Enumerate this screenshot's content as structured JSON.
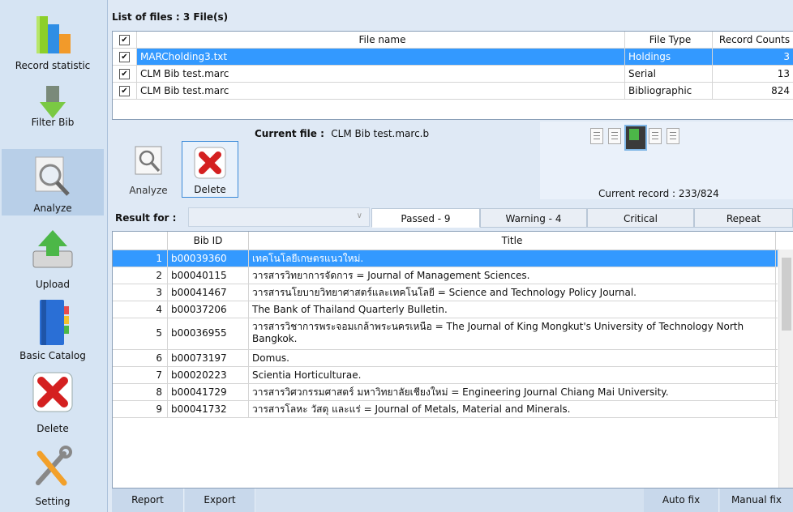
{
  "sidebar": {
    "items": [
      {
        "label": "Record statistic",
        "icon": "bar-chart-icon"
      },
      {
        "label": "Filter Bib",
        "icon": "filter-arrow-icon"
      },
      {
        "label": "Analyze",
        "icon": "magnifier-icon"
      },
      {
        "label": "Upload",
        "icon": "upload-icon"
      },
      {
        "label": "Basic Catalog",
        "icon": "catalog-book-icon"
      },
      {
        "label": "Delete",
        "icon": "delete-x-icon"
      },
      {
        "label": "Setting",
        "icon": "tools-icon"
      }
    ]
  },
  "files": {
    "header": "List of files : 3 File(s)",
    "columns": {
      "name": "File name",
      "type": "File Type",
      "count": "Record Counts"
    },
    "rows": [
      {
        "name": "MARCholding3.txt",
        "type": "Holdings",
        "count": "3"
      },
      {
        "name": "CLM Bib test.marc",
        "type": "Serial",
        "count": "13"
      },
      {
        "name": "CLM Bib test.marc",
        "type": "Bibliographic",
        "count": "824"
      }
    ]
  },
  "toolbar": {
    "analyze_label": "Analyze",
    "delete_label": "Delete",
    "current_file_label": "Current file :",
    "current_file_value": "CLM Bib test.marc.b",
    "current_record": "Current record : 233/824"
  },
  "result": {
    "label": "Result for :",
    "tabs": [
      "Passed - 9",
      "Warning - 4",
      "Critical",
      "Repeat"
    ],
    "columns": {
      "id": "Bib ID",
      "title": "Title"
    },
    "rows": [
      {
        "n": "1",
        "id": "b00039360",
        "title": "เทคโนโลยีเกษตรแนวใหม่."
      },
      {
        "n": "2",
        "id": "b00040115",
        "title": "วารสารวิทยาการจัดการ =  Journal of Management Sciences."
      },
      {
        "n": "3",
        "id": "b00041467",
        "title": "วารสารนโยบายวิทยาศาสตร์และเทคโนโลยี =  Science and Technology Policy Journal."
      },
      {
        "n": "4",
        "id": "b00037206",
        "title": "The Bank of Thailand Quarterly Bulletin."
      },
      {
        "n": "5",
        "id": "b00036955",
        "title": "วารสารวิชาการพระจอมเกล้าพระนครเหนือ =  The Journal of King Mongkut's University of Technology North Bangkok."
      },
      {
        "n": "6",
        "id": "b00073197",
        "title": "Domus."
      },
      {
        "n": "7",
        "id": "b00020223",
        "title": "Scientia Horticulturae."
      },
      {
        "n": "8",
        "id": "b00041729",
        "title": "วารสารวิศวกรรมศาสตร์ มหาวิทยาลัยเชียงใหม่ =  Engineering Journal Chiang Mai University."
      },
      {
        "n": "9",
        "id": "b00041732",
        "title": "วารสารโลหะ วัสดุ และแร่ =  Journal of Metals, Material and Minerals."
      }
    ]
  },
  "bottom": {
    "report": "Report",
    "export": "Export",
    "auto_fix": "Auto fix",
    "manual_fix": "Manual fix"
  },
  "colors": {
    "selection": "#3399ff",
    "panel": "#d6e4f3",
    "delete_red": "#d42020"
  }
}
